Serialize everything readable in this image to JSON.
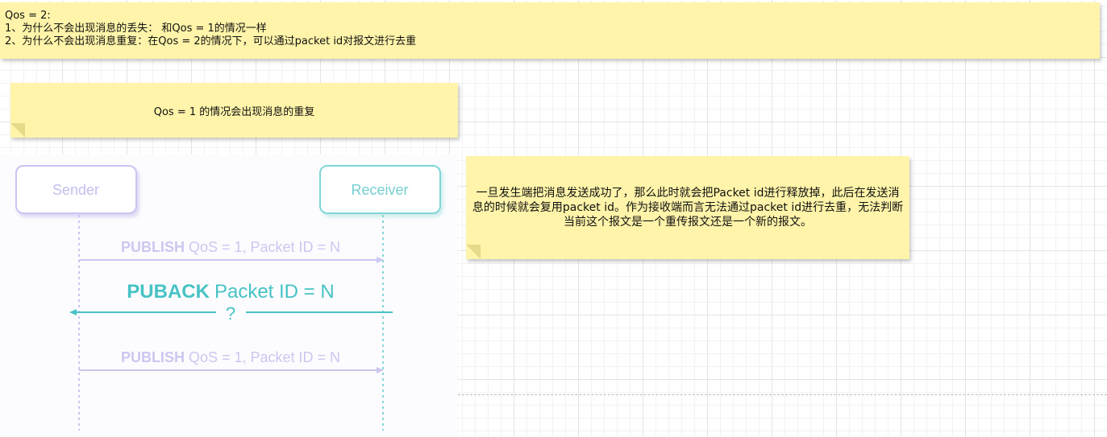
{
  "notes": {
    "top": {
      "lines": [
        "Qos = 2:",
        "1、为什么不会出现消息的丢失： 和Qos = 1的情况一样",
        "2、为什么不会出现消息重复：在Qos = 2的情况下，可以通过packet id对报文进行去重"
      ]
    },
    "middle": {
      "text": "Qos = 1 的情况会出现消息的重复"
    },
    "right": {
      "text": "一旦发生端把消息发送成功了，那么此时就会把Packet id进行释放掉，此后在发送消息的时候就会复用packet id。作为接收端而言无法通过packet id进行去重，无法判断当前这个报文是一个重传报文还是一个新的报文。"
    }
  },
  "sequence_diagram": {
    "sender_label": "Sender",
    "receiver_label": "Receiver",
    "message1": {
      "keyword": "PUBLISH",
      "detail": "QoS = 1, Packet ID = N"
    },
    "message2": {
      "keyword": "PUBACK",
      "detail": "Packet ID = N",
      "lost_marker": "?"
    },
    "message3": {
      "keyword": "PUBLISH",
      "detail": "QoS = 1, Packet ID = N"
    }
  },
  "colors": {
    "sticky_yellow": "#fff4a9",
    "sender_purple": "#b9b3ee",
    "receiver_teal": "#4fc6c8",
    "grid": "#e4e4e4"
  }
}
